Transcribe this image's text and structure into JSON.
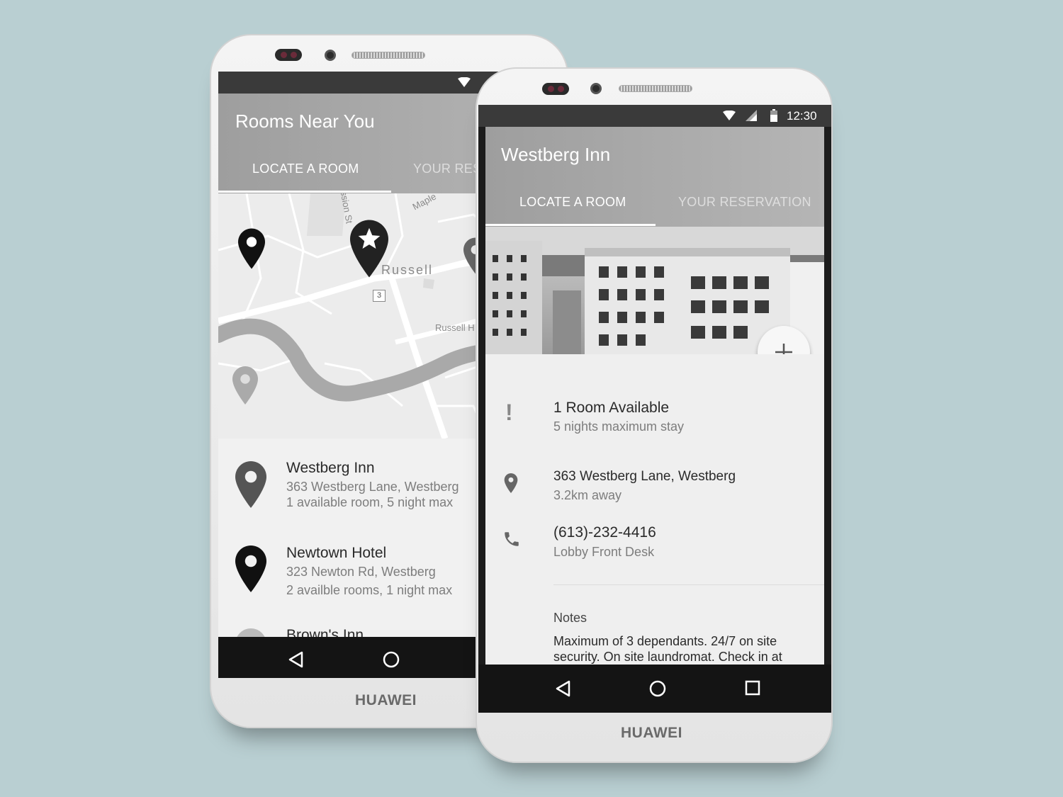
{
  "left_phone": {
    "brand": "HUAWEI",
    "app_title": "Rooms Near You",
    "tabs": [
      {
        "label": "LOCATE A ROOM",
        "active": true
      },
      {
        "label": "YOUR RES",
        "active": false
      }
    ],
    "map": {
      "street_labels": [
        "Maple",
        "Russell",
        "3",
        "Russell H",
        "ssion St"
      ]
    },
    "list": [
      {
        "name": "Westberg Inn",
        "address": "363 Westberg Lane, Westberg",
        "detail": "1 available room, 5 night max",
        "pin_color": "#555555"
      },
      {
        "name": "Newtown Hotel",
        "address": "323 Newton Rd, Westberg",
        "detail": "2 availble rooms, 1 night max",
        "pin_color": "#111111"
      },
      {
        "name": "Brown's Inn",
        "pin_color": "#aaaaaa"
      }
    ]
  },
  "right_phone": {
    "brand": "HUAWEI",
    "status": {
      "time": "12:30"
    },
    "app_title": "Westberg Inn",
    "tabs": [
      {
        "label": "LOCATE A ROOM",
        "active": true
      },
      {
        "label": "YOUR RESERVATION",
        "active": false
      }
    ],
    "fab_icon": "plus-icon",
    "details": [
      {
        "icon": "exclamation-icon",
        "primary": "1 Room Available",
        "secondary": "5 nights maximum stay"
      },
      {
        "icon": "location-pin-icon",
        "primary": "363 Westberg Lane, Westberg",
        "secondary": "3.2km away"
      },
      {
        "icon": "phone-icon",
        "primary": "(613)-232-4416",
        "secondary": "Lobby Front Desk"
      }
    ],
    "notes": {
      "heading": "Notes",
      "text": "Maximum of 3 dependants. 24/7 on site security. On site laundromat. Check in at"
    }
  },
  "colors": {
    "background": "#b9cfd2",
    "appbar": "#a8a8a8",
    "navbar": "#141414"
  }
}
